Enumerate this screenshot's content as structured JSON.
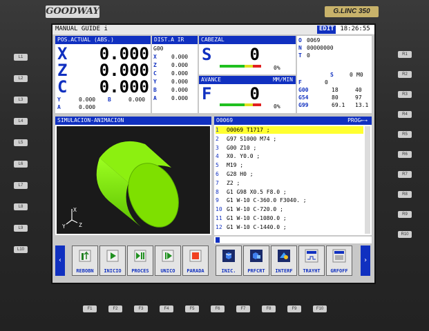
{
  "bezel": {
    "brand": "GOODWAY",
    "model": "G.LINC 350",
    "left_keys": [
      "L1",
      "L2",
      "L3",
      "L4",
      "L5",
      "L6",
      "L7",
      "L8",
      "L9",
      "L10"
    ],
    "right_keys": [
      "R1",
      "R2",
      "R3",
      "R4",
      "R5",
      "R6",
      "R7",
      "R8",
      "R9",
      "R10"
    ],
    "bottom_keys": [
      "F1",
      "F2",
      "F3",
      "F4",
      "F5",
      "F6",
      "F7",
      "F8",
      "F9",
      "F10"
    ]
  },
  "topbar": {
    "mode": "MANUAL GUIDE i",
    "edit": "EDIT",
    "clock": "18:26:55"
  },
  "position": {
    "header": "POS.ACTUAL (ABS.)",
    "axes": [
      {
        "label": "X",
        "value": "0.000"
      },
      {
        "label": "Z",
        "value": "0.000"
      },
      {
        "label": "C",
        "value": "0.000"
      }
    ],
    "small": [
      {
        "label": "Y",
        "value": "0.000"
      },
      {
        "label": "B",
        "value": "0.000"
      },
      {
        "label": "A",
        "value": "0.000"
      }
    ]
  },
  "dist": {
    "header": "DIST.A IR",
    "code": "G00",
    "rows": [
      {
        "label": "X",
        "value": "0.000"
      },
      {
        "label": "Z",
        "value": "0.000"
      },
      {
        "label": "C",
        "value": "0.000"
      },
      {
        "label": "Y",
        "value": "0.000"
      },
      {
        "label": "B",
        "value": "0.000"
      },
      {
        "label": "A",
        "value": "0.000"
      }
    ]
  },
  "spindle": {
    "header": "CABEZAL",
    "axis": "S",
    "value": "0",
    "percent": "0%",
    "load": 0
  },
  "feed": {
    "header": "AVANCE",
    "unit": "MM/MIN",
    "axis": "F",
    "value": "0",
    "percent": "0%",
    "load": 0
  },
  "modal": {
    "o": {
      "label": "O",
      "value": "0069"
    },
    "n": {
      "label": "N",
      "value": "00000000"
    },
    "t": {
      "label": "T",
      "value": "0"
    },
    "s_line": {
      "label": "S",
      "value": "0",
      "m": "M0"
    },
    "f_line": {
      "label": "F",
      "value": "0"
    },
    "rows": [
      {
        "code": "G00",
        "a": "18",
        "b": "40"
      },
      {
        "code": "G54",
        "a": "80",
        "b": "97"
      },
      {
        "code": "G99",
        "a": "69.1",
        "b": "13.1"
      }
    ]
  },
  "simulation": {
    "header": "SIMULACION-ANIMACION",
    "axes": {
      "x": "X",
      "y": "Y",
      "z": "Z"
    }
  },
  "program": {
    "header": "O0069",
    "mode": "PROG←→",
    "lines": [
      {
        "n": "1",
        "text": "O0069 T1717 ;",
        "highlight": true
      },
      {
        "n": "2",
        "text": "G97 S1000 M74 ;",
        "highlight": false
      },
      {
        "n": "3",
        "text": "G00 Z10 ;",
        "highlight": false
      },
      {
        "n": "4",
        "text": "X0. Y0.0 ;",
        "highlight": false
      },
      {
        "n": "5",
        "text": "M19 ;",
        "highlight": false
      },
      {
        "n": "6",
        "text": "G28 H0 ;",
        "highlight": false
      },
      {
        "n": "7",
        "text": "Z2 ;",
        "highlight": false
      },
      {
        "n": "8",
        "text": "G1 G98 X0.5 F8.0 ;",
        "highlight": false
      },
      {
        "n": "9",
        "text": "G1 W-10 C-360.0 F3040. ;",
        "highlight": false
      },
      {
        "n": "10",
        "text": "G1 W-10 C-720.0 ;",
        "highlight": false
      },
      {
        "n": "11",
        "text": "G1 W-10 C-1080.0 ;",
        "highlight": false
      },
      {
        "n": "12",
        "text": "G1 W-10 C-1440.0 ;",
        "highlight": false
      }
    ]
  },
  "softkeys": {
    "prev": "‹",
    "next": "›",
    "items": [
      {
        "label": "REBOBN",
        "icon": "rewind-icon"
      },
      {
        "label": "INICIO",
        "icon": "play-icon"
      },
      {
        "label": "PROCES",
        "icon": "play-pause-icon"
      },
      {
        "label": "UNICO",
        "icon": "single-block-icon"
      },
      {
        "label": "PARADA",
        "icon": "stop-icon"
      },
      {
        "label": "INIC.",
        "icon": "cube-icon"
      },
      {
        "label": "PRFCRT",
        "icon": "cube-section-icon"
      },
      {
        "label": "INTERF",
        "icon": "interference-icon"
      },
      {
        "label": "TRAYHT",
        "icon": "trajectory-icon"
      },
      {
        "label": "GRFOFF",
        "icon": "graphic-off-icon"
      }
    ]
  },
  "colors": {
    "accent": "#1030c0",
    "highlight": "#ffff30",
    "part": "#7ee000"
  }
}
